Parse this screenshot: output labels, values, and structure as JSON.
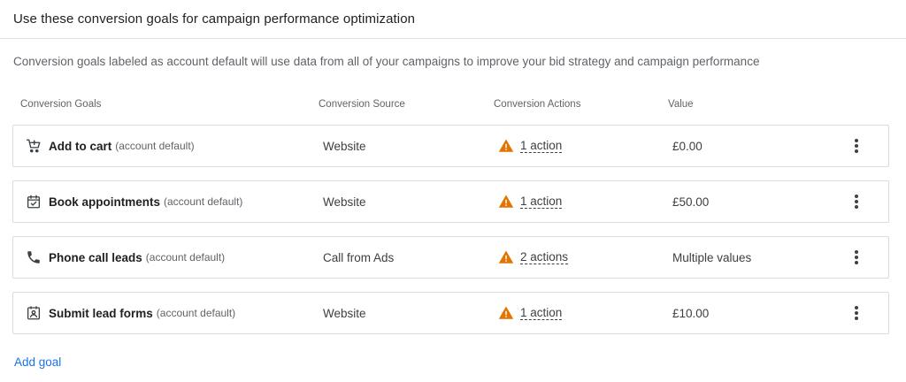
{
  "header": {
    "title": "Use these conversion goals for campaign performance optimization"
  },
  "description": "Conversion goals labeled as account default will use data from all of your campaigns to improve your bid strategy and campaign performance",
  "columns": {
    "goals": "Conversion Goals",
    "source": "Conversion Source",
    "actions": "Conversion Actions",
    "value": "Value"
  },
  "rows": [
    {
      "icon": "shopping-cart-icon",
      "name": "Add to cart",
      "tag": "(account default)",
      "source": "Website",
      "actions": "1 action",
      "value": "£0.00"
    },
    {
      "icon": "calendar-check-icon",
      "name": "Book appointments",
      "tag": "(account default)",
      "source": "Website",
      "actions": "1 action",
      "value": "£50.00"
    },
    {
      "icon": "phone-icon",
      "name": "Phone call leads",
      "tag": "(account default)",
      "source": "Call from Ads",
      "actions": "2 actions",
      "value": "Multiple values"
    },
    {
      "icon": "contact-form-icon",
      "name": "Submit lead forms",
      "tag": "(account default)",
      "source": "Website",
      "actions": "1 action",
      "value": "£10.00"
    }
  ],
  "warning_icon": "warning-triangle-icon",
  "warning_color": "#e37400",
  "link_color": "#1a73e8",
  "add_goal_label": "Add goal"
}
